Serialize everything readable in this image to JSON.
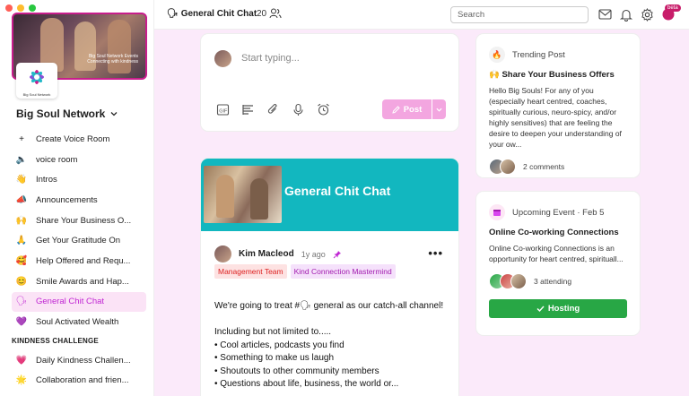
{
  "window": {
    "traffic_colors": [
      "#ff5f57",
      "#febc2e",
      "#28c840"
    ]
  },
  "sidebar": {
    "banner_text_line1": "Big Soul Network Events",
    "banner_text_line2": "Connecting with kindness",
    "logo_text": "Big Soul Network",
    "community_name": "Big Soul Network",
    "items": [
      {
        "icon": "+",
        "label": "Create Voice Room",
        "active": false
      },
      {
        "icon": "🔈",
        "label": "voice room",
        "active": false
      },
      {
        "icon": "👋",
        "label": "Intros",
        "active": false
      },
      {
        "icon": "📣",
        "label": "Announcements",
        "active": false
      },
      {
        "icon": "🙌",
        "label": "Share Your Business O...",
        "active": false
      },
      {
        "icon": "🙏",
        "label": "Get Your Gratitude On",
        "active": false
      },
      {
        "icon": "🥰",
        "label": "Help Offered and Requ...",
        "active": false
      },
      {
        "icon": "😊",
        "label": "Smile Awards and Hap...",
        "active": false
      },
      {
        "icon": "🗣",
        "label": "General Chit Chat",
        "active": true
      },
      {
        "icon": "💜",
        "label": "Soul Activated Wealth",
        "active": false
      }
    ],
    "section_kindness": "KINDNESS CHALLENGE",
    "kindness_items": [
      {
        "icon": "💗",
        "label": "Daily Kindness Challen..."
      },
      {
        "icon": "🌟",
        "label": "Collaboration and frien..."
      }
    ]
  },
  "topbar": {
    "channel_icon": "🗣",
    "channel_title": "General Chit Chat",
    "member_count": "20",
    "search_placeholder": "Search",
    "beta_label": "beta"
  },
  "composer": {
    "placeholder": "Start typing...",
    "post_label": "Post"
  },
  "post": {
    "hero_title": "General Chit Chat",
    "author": "Kim Macleod",
    "time_ago": "1y ago",
    "tags": [
      "Management Team",
      "Kind Connection Mastermind"
    ],
    "line1": "We're going to treat #🗣 general as our catch-all channel!",
    "line2": "Including but not limited to.....",
    "bullets": [
      "• Cool articles, podcasts you find",
      "• Something to make us laugh",
      "• Shoutouts to other community members",
      "• Questions about life, business, the world or..."
    ]
  },
  "trending": {
    "header": "Trending Post",
    "icon": "🔥",
    "title": "🙌 Share Your Business Offers",
    "description": "Hello Big Souls! For any of you (especially heart centred, coaches, spiritually curious, neuro-spicy, and/or highly sensitives) that are feeling the desire to deepen your understanding of your ow...",
    "comments": "2 comments"
  },
  "event": {
    "header": "Upcoming Event · Feb 5",
    "title": "Online Co-working Connections",
    "description": "Online Co-working Connections is an opportunity for heart centred, spirituall...",
    "attending": "3 attending",
    "hosting_label": "Hosting"
  },
  "colors": {
    "accent": "#c026d3",
    "teal": "#12b7bf",
    "green": "#28a745"
  }
}
